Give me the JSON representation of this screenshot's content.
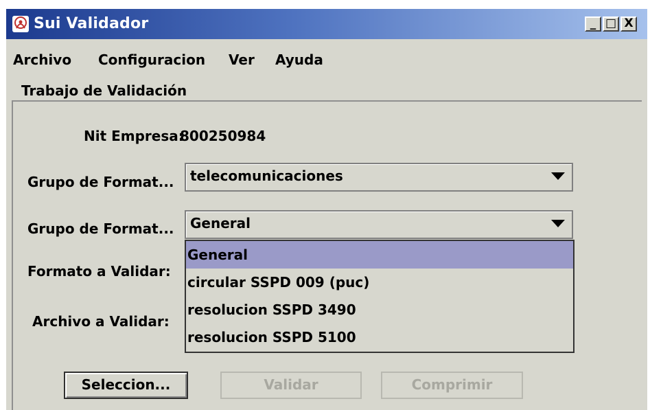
{
  "window": {
    "title": "Sui Validador",
    "controls": {
      "minimize": "_",
      "maximize": "□",
      "close": "X"
    }
  },
  "menu": [
    "Archivo",
    "Configuracion",
    "Ver",
    "Ayuda"
  ],
  "panel": {
    "title": "Trabajo de Validación",
    "nit_label": "Nit Empresa:",
    "nit_value": "800250984",
    "grupo1_label": "Grupo de Format...",
    "grupo1_value": "telecomunicaciones",
    "grupo2_label": "Grupo de Format...",
    "grupo2_value": "General",
    "formato_label": "Formato a Validar:",
    "archivo_label": "Archivo a Validar:",
    "dropdown_options": [
      "General",
      "circular SSPD 009 (puc)",
      "resolucion SSPD 3490",
      "resolucion SSPD 5100"
    ],
    "selected_option": "General"
  },
  "buttons": {
    "seleccion": "Seleccion...",
    "validar": "Validar",
    "comprimir": "Comprimir"
  },
  "colors": {
    "title_gradient_start": "#1c3a8e",
    "title_gradient_end": "#a6c1ec",
    "window_bg": "#d7d7ce",
    "selection_bg": "#9a9ac8",
    "disabled_text": "#a8a8a0"
  }
}
